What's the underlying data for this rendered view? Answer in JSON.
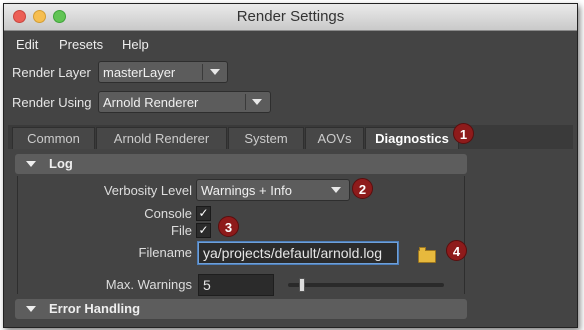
{
  "window": {
    "title": "Render Settings"
  },
  "menubar": {
    "items": [
      "Edit",
      "Presets",
      "Help"
    ]
  },
  "render_layer": {
    "label": "Render Layer",
    "value": "masterLayer"
  },
  "render_using": {
    "label": "Render Using",
    "value": "Arnold Renderer"
  },
  "tabs": {
    "items": [
      "Common",
      "Arnold Renderer",
      "System",
      "AOVs",
      "Diagnostics"
    ],
    "active": "Diagnostics"
  },
  "log_section": {
    "title": "Log",
    "verbosity_label": "Verbosity Level",
    "verbosity_value": "Warnings + Info",
    "console_label": "Console",
    "console_checked": true,
    "file_label": "File",
    "file_checked": true,
    "filename_label": "Filename",
    "filename_value": "ya/projects/default/arnold.log",
    "max_warnings_label": "Max. Warnings",
    "max_warnings_value": "5",
    "max_warnings_slider_fraction": 0.05
  },
  "error_section": {
    "title": "Error Handling"
  },
  "callouts": [
    "1",
    "2",
    "3",
    "4"
  ],
  "colors": {
    "callout": "#8e1b1b",
    "panel": "#444444",
    "focus": "#6fa0d8"
  },
  "icons": {
    "check": "✓",
    "folder": "folder-icon"
  }
}
